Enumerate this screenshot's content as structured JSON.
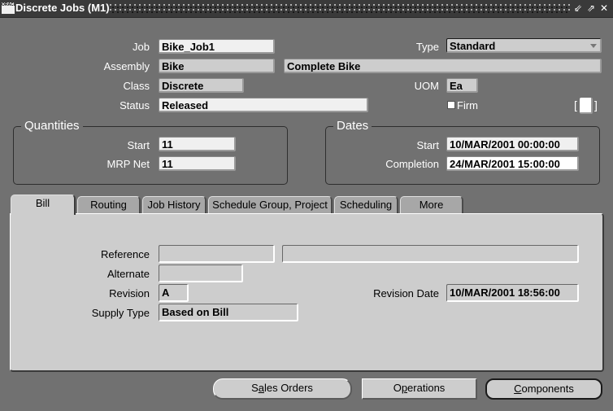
{
  "window": {
    "title": "Discrete Jobs (M1)",
    "logo_text": "ORACLE",
    "controls": [
      {
        "name": "minimize-icon",
        "glyph": "⇙"
      },
      {
        "name": "maximize-icon",
        "glyph": "⇗"
      },
      {
        "name": "close-icon",
        "glyph": "✕"
      }
    ]
  },
  "header": {
    "job": {
      "label": "Job",
      "value": "Bike_Job1"
    },
    "type": {
      "label": "Type",
      "value": "Standard"
    },
    "assembly": {
      "label": "Assembly",
      "value": "Bike",
      "description": "Complete Bike"
    },
    "class": {
      "label": "Class",
      "value": "Discrete"
    },
    "uom": {
      "label": "UOM",
      "value": "Ea"
    },
    "status": {
      "label": "Status",
      "value": "Released"
    },
    "firm": {
      "label": "Firm",
      "checked": false
    },
    "flex_bracket_left": "[",
    "flex_bracket_right": "]"
  },
  "quantities": {
    "title": "Quantities",
    "start": {
      "label": "Start",
      "value": "11"
    },
    "mrp_net": {
      "label": "MRP Net",
      "value": "11"
    }
  },
  "dates": {
    "title": "Dates",
    "start": {
      "label": "Start",
      "value": "10/MAR/2001 00:00:00"
    },
    "completion": {
      "label": "Completion",
      "value": "24/MAR/2001 15:00:00"
    }
  },
  "tabs": [
    {
      "label": "Bill",
      "active": true
    },
    {
      "label": "Routing",
      "active": false
    },
    {
      "label": "Job History",
      "active": false
    },
    {
      "label": "Schedule Group, Project",
      "active": false
    },
    {
      "label": "Scheduling",
      "active": false
    },
    {
      "label": "More",
      "active": false
    }
  ],
  "bill": {
    "reference": {
      "label": "Reference",
      "value": "",
      "description": ""
    },
    "alternate": {
      "label": "Alternate",
      "value": ""
    },
    "revision": {
      "label": "Revision",
      "value": "A"
    },
    "revision_date": {
      "label": "Revision Date",
      "value": "10/MAR/2001 18:56:00"
    },
    "supply_type": {
      "label": "Supply Type",
      "value": "Based on Bill"
    }
  },
  "buttons": {
    "sales_orders": {
      "pre": "S",
      "mnemonic": "a",
      "post": "les Orders"
    },
    "operations": {
      "pre": "O",
      "mnemonic": "p",
      "post": "erations"
    },
    "components": {
      "pre": "",
      "mnemonic": "C",
      "post": "omponents"
    }
  }
}
